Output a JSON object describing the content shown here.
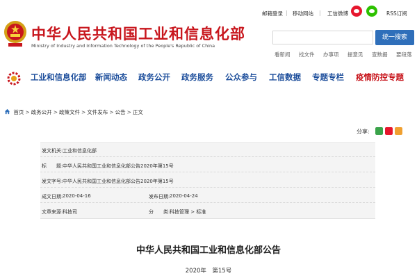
{
  "header": {
    "title": "中华人民共和国工业和信息化部",
    "subtitle": "Ministry of Industry and Information Technology of the People's Republic of China",
    "top_links": [
      "邮箱登录",
      "移动网站",
      "工信微博",
      "RSS订阅"
    ],
    "search_placeholder": "",
    "search_button": "统一搜索",
    "quick_links": [
      "看新闻",
      "找文件",
      "办事项",
      "提意见",
      "查数据",
      "要段落"
    ]
  },
  "nav": {
    "items": [
      "工业和信息化部",
      "新闻动态",
      "政务公开",
      "政务服务",
      "公众参与",
      "工信数据",
      "专题专栏",
      "疫情防控专题"
    ]
  },
  "breadcrumb": [
    "首页",
    "政务公开",
    "政策文件",
    "文件发布",
    "公告",
    "正文"
  ],
  "share": {
    "label": "分享:"
  },
  "meta": {
    "issuing_authority_label": "发文机关:",
    "issuing_authority": "工业和信息化部",
    "title_label": "标　　题:",
    "title": "中华人民共和国工业和信息化部公告2020年第15号",
    "doc_number_label": "发文字号:",
    "doc_number": "中华人民共和国工业和信息化部公告2020年第15号",
    "created_label": "成文日期:",
    "created": "2020-04-16",
    "published_label": "发布日期:",
    "published": "2020-04-24",
    "source_label": "文章来源:",
    "source": "科技司",
    "category_label": "分　　类:",
    "category": "科技管理 > 标准"
  },
  "document": {
    "title": "中华人民共和国工业和信息化部公告",
    "number": "2020年　第15号"
  },
  "colors": {
    "brand_red": "#c8161d",
    "nav_blue": "#1e4f9c",
    "search_blue": "#2f6fba"
  }
}
